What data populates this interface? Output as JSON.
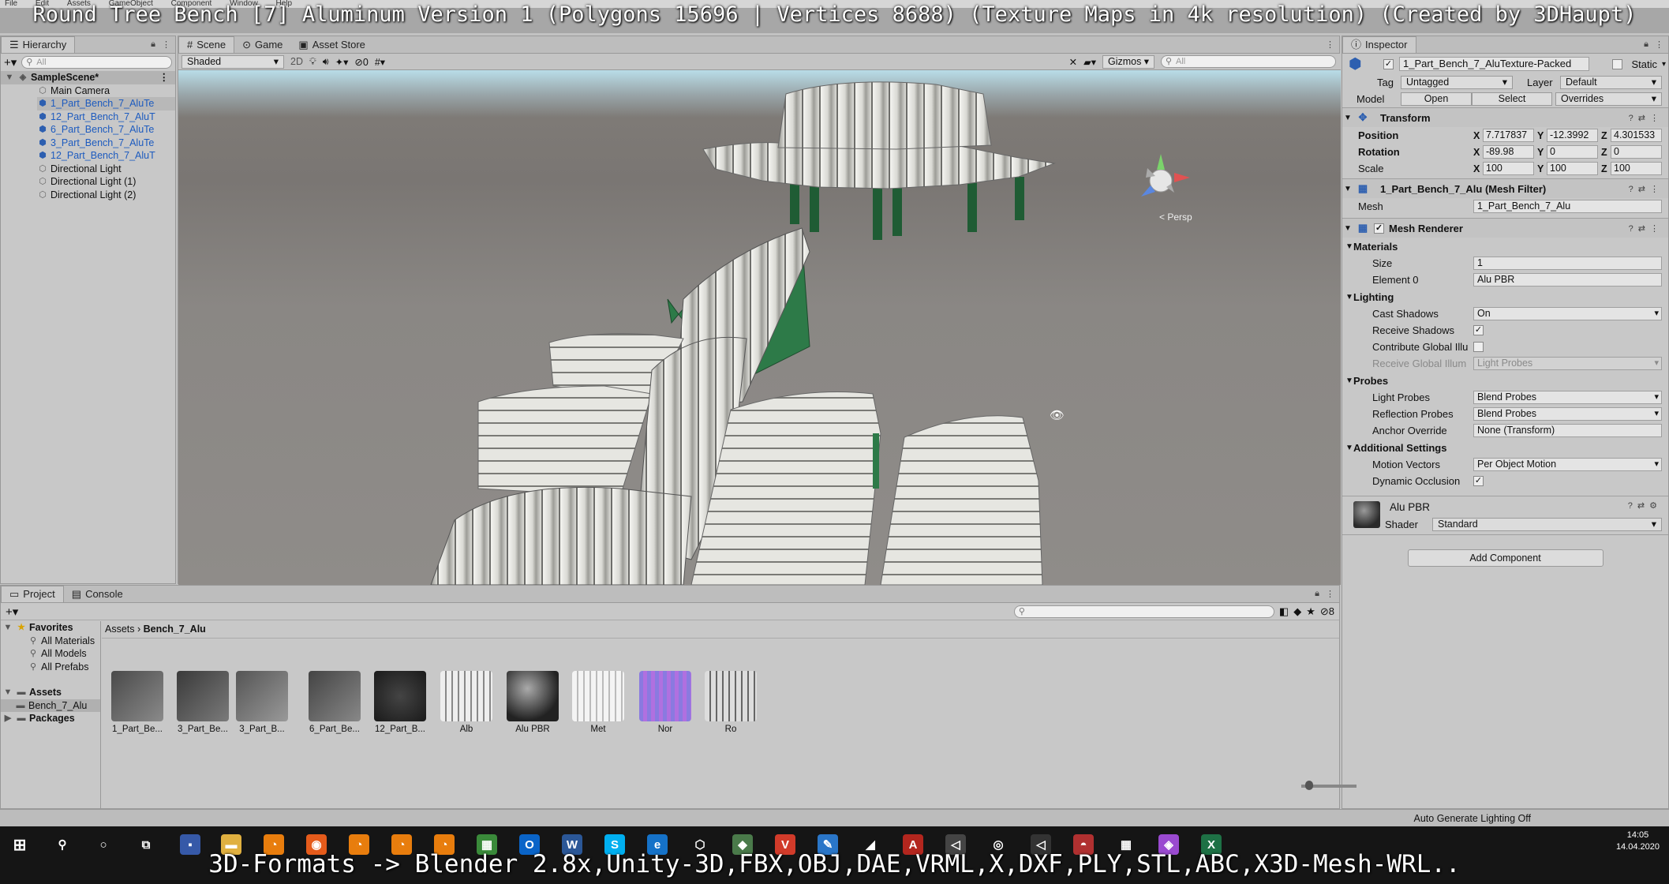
{
  "title_overlay": "Round Tree Bench [7] Aluminum Version 1 (Polygons 15696 | Vertices 8688) (Texture Maps in 4k resolution) (Created by 3DHaupt)",
  "bottom_overlay": "3D-Formats -> Blender 2.8x,Unity-3D,FBX,OBJ,DAE,VRML,X,DXF,PLY,STL,ABC,X3D-Mesh-WRL..",
  "menu": [
    "File",
    "Edit",
    "Assets",
    "GameObject",
    "Component",
    "Window",
    "Help"
  ],
  "hierarchy": {
    "tab": "Hierarchy",
    "search_placeholder": "All",
    "scene": "SampleScene*",
    "items": [
      {
        "label": "Main Camera",
        "blue": false
      },
      {
        "label": "1_Part_Bench_7_AluTe",
        "blue": true
      },
      {
        "label": "12_Part_Bench_7_AluT",
        "blue": true
      },
      {
        "label": "6_Part_Bench_7_AluTe",
        "blue": true
      },
      {
        "label": "3_Part_Bench_7_AluTe",
        "blue": true
      },
      {
        "label": "12_Part_Bench_7_AluT",
        "blue": true
      },
      {
        "label": "Directional Light",
        "blue": false
      },
      {
        "label": "Directional Light (1)",
        "blue": false
      },
      {
        "label": "Directional Light (2)",
        "blue": false
      }
    ]
  },
  "scene": {
    "tabs": [
      "Scene",
      "Game",
      "Asset Store"
    ],
    "shading": "Shaded",
    "mode2d": "2D",
    "hidden_count": "0",
    "gizmos": "Gizmos",
    "search_placeholder": "All",
    "persp": "< Persp"
  },
  "inspector": {
    "tab": "Inspector",
    "object_name": "1_Part_Bench_7_AluTexture-Packed",
    "static": "Static",
    "tag_label": "Tag",
    "tag": "Untagged",
    "layer_label": "Layer",
    "layer": "Default",
    "model_label": "Model",
    "open": "Open",
    "select": "Select",
    "overrides": "Overrides",
    "transform": {
      "title": "Transform",
      "position_label": "Position",
      "rotation_label": "Rotation",
      "scale_label": "Scale",
      "position": {
        "x": "7.717837",
        "y": "-12.3992",
        "z": "4.301533"
      },
      "rotation": {
        "x": "-89.98",
        "y": "0",
        "z": "0"
      },
      "scale": {
        "x": "100",
        "y": "100",
        "z": "100"
      }
    },
    "mesh_filter": {
      "title": "1_Part_Bench_7_Alu (Mesh Filter)",
      "mesh_label": "Mesh",
      "mesh": "1_Part_Bench_7_Alu"
    },
    "mesh_renderer": {
      "title": "Mesh Renderer",
      "materials": "Materials",
      "size_label": "Size",
      "size": "1",
      "element0_label": "Element 0",
      "element0": "Alu PBR",
      "lighting": "Lighting",
      "cast_shadows_label": "Cast Shadows",
      "cast_shadows": "On",
      "receive_shadows_label": "Receive Shadows",
      "contribute_gi_label": "Contribute Global Illu",
      "receive_gi_label": "Receive Global Illum",
      "receive_gi": "Light Probes",
      "probes": "Probes",
      "light_probes_label": "Light Probes",
      "light_probes": "Blend Probes",
      "reflection_probes_label": "Reflection Probes",
      "reflection_probes": "Blend Probes",
      "anchor_label": "Anchor Override",
      "anchor": "None (Transform)",
      "additional": "Additional Settings",
      "motion_label": "Motion Vectors",
      "motion": "Per Object Motion",
      "dynamic_occ_label": "Dynamic Occlusion"
    },
    "material": {
      "name": "Alu PBR",
      "shader_label": "Shader",
      "shader": "Standard"
    },
    "add_component": "Add Component"
  },
  "project": {
    "tabs": [
      "Project",
      "Console"
    ],
    "favorites": "Favorites",
    "fav_items": [
      "All Materials",
      "All Models",
      "All Prefabs"
    ],
    "assets": "Assets",
    "assets_child": "Bench_7_Alu",
    "packages": "Packages",
    "breadcrumb": [
      "Assets",
      "Bench_7_Alu"
    ],
    "hidden_count": "8",
    "items": [
      "1_Part_Be...",
      "3_Part_Be...",
      "3_Part_B...",
      "6_Part_Be...",
      "12_Part_B...",
      "Alb",
      "Alu PBR",
      "Met",
      "Nor",
      "Ro"
    ]
  },
  "status": "Auto Generate Lighting Off",
  "clock": {
    "time": "14:05",
    "date": "14.04.2020"
  }
}
